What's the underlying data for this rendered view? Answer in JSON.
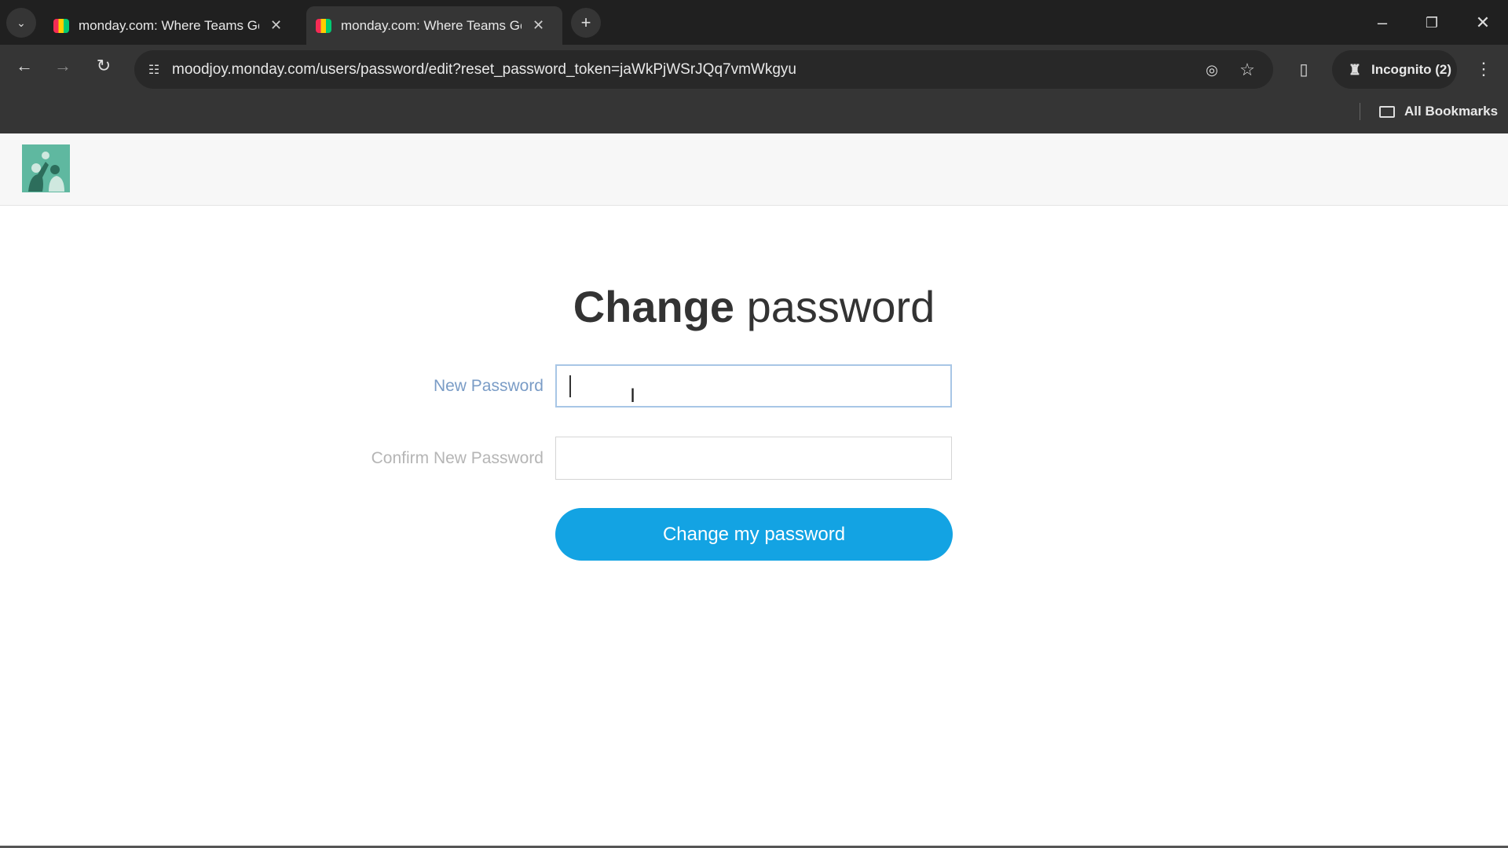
{
  "browser": {
    "tabs": [
      {
        "title": "monday.com: Where Teams Get",
        "active": false
      },
      {
        "title": "monday.com: Where Teams Get",
        "active": true
      }
    ],
    "url": "moodjoy.monday.com/users/password/edit?reset_password_token=jaWkPjWSrJQq7vmWkgyu",
    "incognito_label": "Incognito (2)",
    "bookmarks_label": "All Bookmarks"
  },
  "page": {
    "title_bold": "Change",
    "title_rest": "password",
    "new_password_label": "New Password",
    "new_password_value": "",
    "confirm_password_label": "Confirm New Password",
    "confirm_password_value": "",
    "submit_label": "Change my password",
    "colors": {
      "button": "#13a3e3",
      "label_focus": "#7a9cc6",
      "label": "#b5b5b5"
    }
  }
}
